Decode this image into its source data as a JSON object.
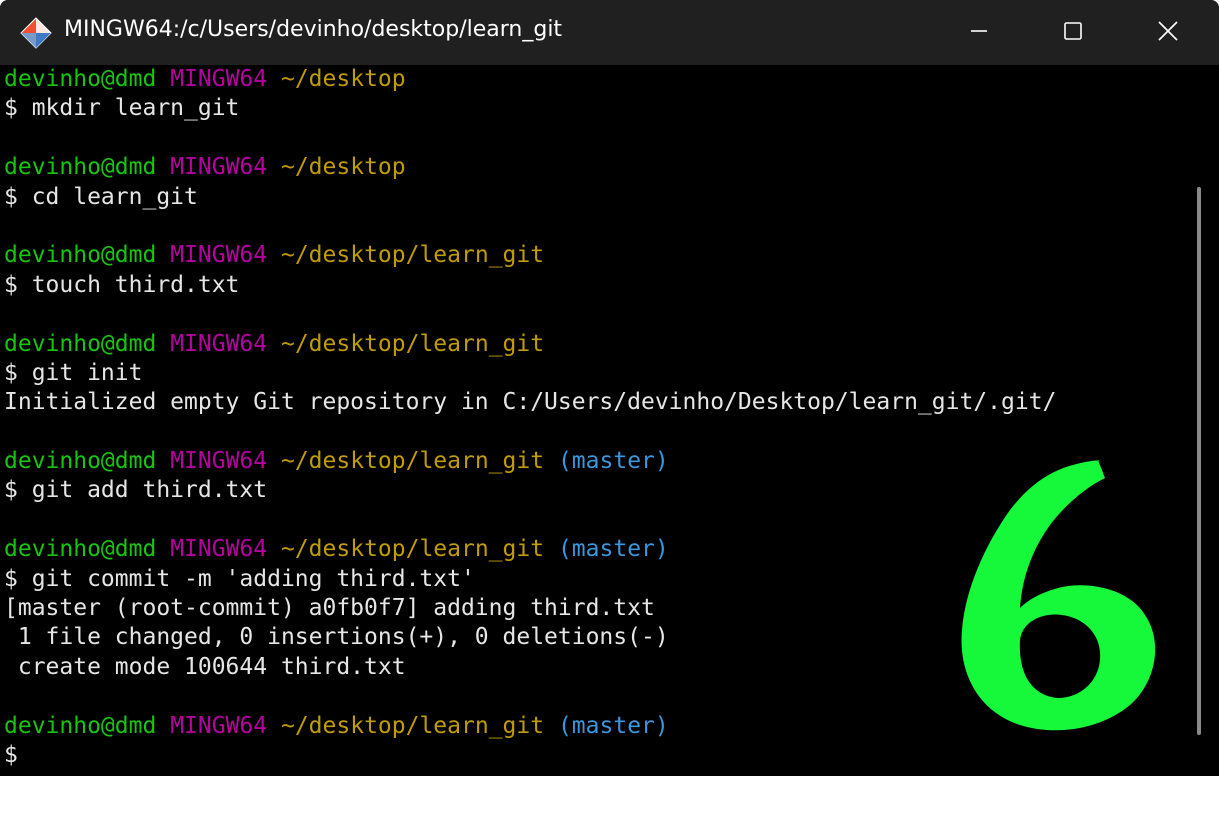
{
  "window": {
    "title": "MINGW64:/c/Users/devinho/desktop/learn_git",
    "icon": "git-diamond-icon",
    "controls": {
      "minimize": "minimize-icon",
      "maximize": "maximize-icon",
      "close": "close-icon"
    }
  },
  "colors": {
    "user": "#16c60c",
    "host": "#b4009e",
    "path": "#c19c00",
    "branch": "#3a96dd",
    "text": "#e6e6e6",
    "overlay": "#16f93a"
  },
  "terminal": {
    "lines": [
      {
        "type": "prompt",
        "user": "devinho@dmd",
        "host": "MINGW64",
        "path": "~/desktop",
        "branch": ""
      },
      {
        "type": "text",
        "text": "$ mkdir learn_git"
      },
      {
        "type": "blank",
        "text": ""
      },
      {
        "type": "prompt",
        "user": "devinho@dmd",
        "host": "MINGW64",
        "path": "~/desktop",
        "branch": ""
      },
      {
        "type": "text",
        "text": "$ cd learn_git"
      },
      {
        "type": "blank",
        "text": ""
      },
      {
        "type": "prompt",
        "user": "devinho@dmd",
        "host": "MINGW64",
        "path": "~/desktop/learn_git",
        "branch": ""
      },
      {
        "type": "text",
        "text": "$ touch third.txt"
      },
      {
        "type": "blank",
        "text": ""
      },
      {
        "type": "prompt",
        "user": "devinho@dmd",
        "host": "MINGW64",
        "path": "~/desktop/learn_git",
        "branch": ""
      },
      {
        "type": "text",
        "text": "$ git init"
      },
      {
        "type": "text",
        "text": "Initialized empty Git repository in C:/Users/devinho/Desktop/learn_git/.git/"
      },
      {
        "type": "blank",
        "text": ""
      },
      {
        "type": "prompt",
        "user": "devinho@dmd",
        "host": "MINGW64",
        "path": "~/desktop/learn_git",
        "branch": "(master)"
      },
      {
        "type": "text",
        "text": "$ git add third.txt"
      },
      {
        "type": "blank",
        "text": ""
      },
      {
        "type": "prompt",
        "user": "devinho@dmd",
        "host": "MINGW64",
        "path": "~/desktop/learn_git",
        "branch": "(master)"
      },
      {
        "type": "text",
        "text": "$ git commit -m 'adding third.txt'"
      },
      {
        "type": "text",
        "text": "[master (root-commit) a0fb0f7] adding third.txt"
      },
      {
        "type": "text",
        "text": " 1 file changed, 0 insertions(+), 0 deletions(-)"
      },
      {
        "type": "text",
        "text": " create mode 100644 third.txt"
      },
      {
        "type": "blank",
        "text": ""
      },
      {
        "type": "prompt",
        "user": "devinho@dmd",
        "host": "MINGW64",
        "path": "~/desktop/learn_git",
        "branch": "(master)"
      },
      {
        "type": "text",
        "text": "$"
      }
    ]
  },
  "overlay": {
    "shape": "handwritten-six-annotation"
  }
}
